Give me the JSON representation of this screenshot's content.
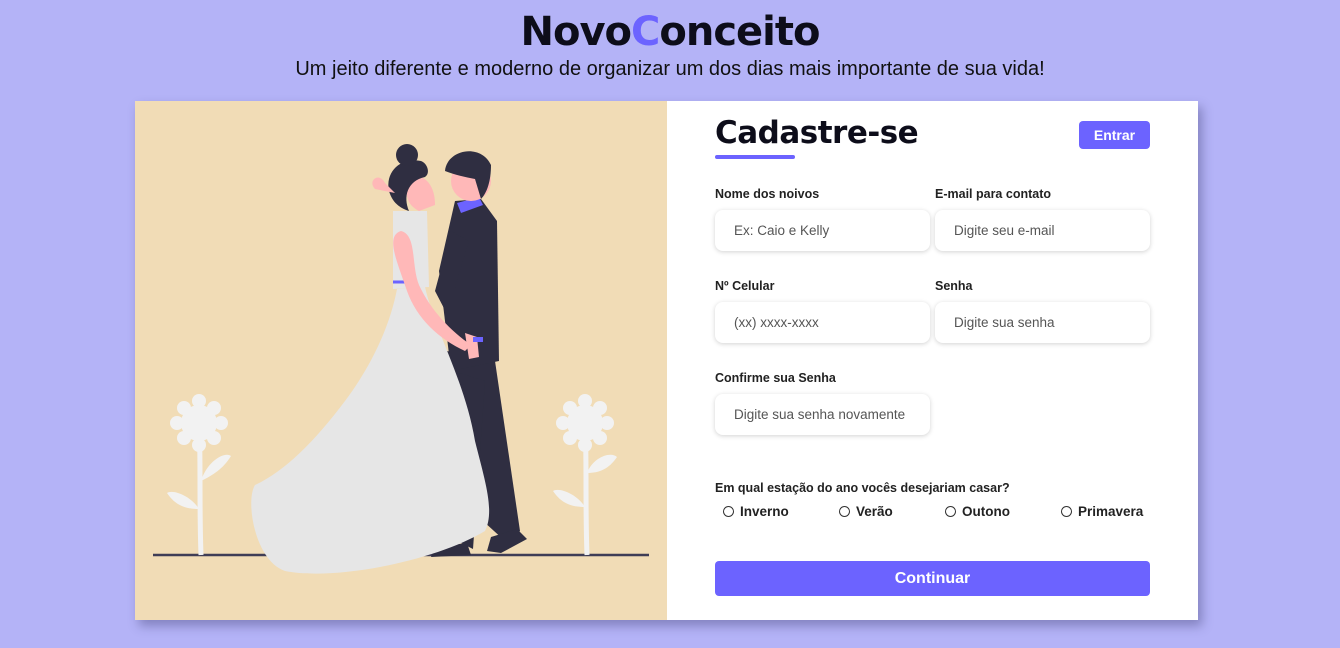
{
  "header": {
    "brand_part1": "Novo",
    "brand_accent": "C",
    "brand_part2": "onceito",
    "tagline": "Um jeito diferente e moderno de organizar um dos dias mais importante de sua vida!"
  },
  "form": {
    "title": "Cadastre-se",
    "login_label": "Entrar",
    "fields": [
      {
        "label": "Nome dos noivos",
        "placeholder": "Ex: Caio e Kelly"
      },
      {
        "label": "E-mail para contato",
        "placeholder": "Digite seu e-mail"
      },
      {
        "label": "Nº Celular",
        "placeholder": "(xx) xxxx-xxxx"
      },
      {
        "label": "Senha",
        "placeholder": "Digite sua senha"
      },
      {
        "label": "Confirme sua Senha",
        "placeholder": "Digite sua senha novamente"
      }
    ],
    "season_question": "Em qual estação do ano vocês desejariam casar?",
    "seasons": [
      "Inverno",
      "Verão",
      "Outono",
      "Primavera"
    ],
    "continue_label": "Continuar"
  },
  "colors": {
    "background": "#b4b3f7",
    "accent": "#6c63ff",
    "illustration_bg": "#f1dcb6"
  },
  "illustration": {
    "icon": "wedding-couple-illustration"
  }
}
